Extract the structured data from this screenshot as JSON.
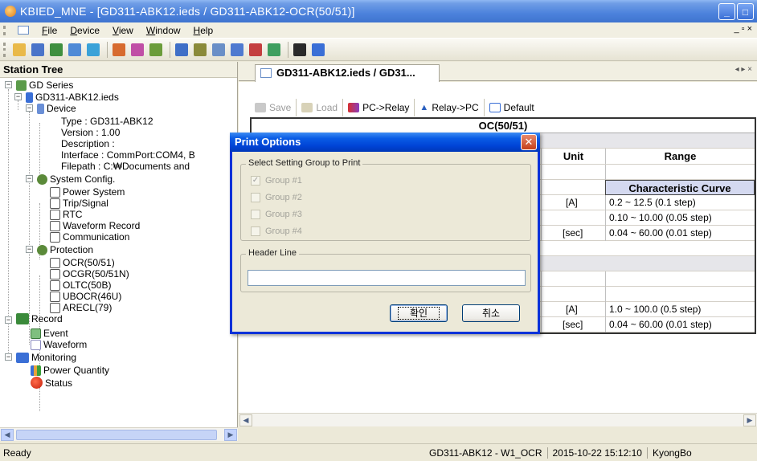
{
  "window": {
    "title": "KBIED_MNE - [GD311-ABK12.ieds / GD311-ABK12-OCR(50/51)]",
    "minimize": "_",
    "restore": "□",
    "close": "X"
  },
  "menu": {
    "items": [
      {
        "ul": "F",
        "rest": "ile"
      },
      {
        "ul": "D",
        "rest": "evice"
      },
      {
        "ul": "V",
        "rest": "iew"
      },
      {
        "ul": "W",
        "rest": "indow"
      },
      {
        "ul": "H",
        "rest": "elp"
      }
    ],
    "mdi_controls": "_ ▫ ×"
  },
  "toolbar": {
    "icons": [
      {
        "name": "open-folder-icon",
        "color": "#e9b949"
      },
      {
        "name": "save-icon",
        "color": "#4a74c9"
      },
      {
        "name": "connect-icon",
        "color": "#3f8f3f"
      },
      {
        "name": "network-icon",
        "color": "#4f8ad6"
      },
      {
        "name": "tree-icon",
        "color": "#3aa2d8"
      },
      {
        "name": "settings-icon",
        "color": "#d76b2f"
      },
      {
        "name": "paint-icon",
        "color": "#c04fa6"
      },
      {
        "name": "download-icon",
        "color": "#6b9c3a"
      },
      {
        "name": "window-icon",
        "color": "#3f6fc7"
      },
      {
        "name": "list-icon",
        "color": "#8a8a3a"
      },
      {
        "name": "tile-icon",
        "color": "#6a8fc7"
      },
      {
        "name": "wave-icon",
        "color": "#4f7ad0"
      },
      {
        "name": "waveform-icon",
        "color": "#c43f3f"
      },
      {
        "name": "transfer-icon",
        "color": "#3f9f5f"
      },
      {
        "name": "close-icon",
        "color": "#2a2a2a"
      },
      {
        "name": "help-icon",
        "color": "#3a6fd6"
      }
    ]
  },
  "station_tree": {
    "title": "Station Tree",
    "nodes": {
      "gd_series": "GD Series",
      "file": "GD311-ABK12.ieds",
      "device": "Device",
      "type": "Type : GD311-ABK12",
      "version": "Version : 1.00",
      "description": "Description :",
      "interface": "Interface : CommPort:COM4, B",
      "filepath": "Filepath : C:₩Documents and",
      "system_config": "System Config.",
      "power_system": "Power System",
      "trip_signal": "Trip/Signal",
      "rtc": "RTC",
      "waveform_record": "Waveform Record",
      "communication": "Communication",
      "protection": "Protection",
      "ocr": "OCR(50/51)",
      "ocgr": "OCGR(50/51N)",
      "oltc": "OLTC(50B)",
      "ubocr": "UBOCR(46U)",
      "arecl": "ARECL(79)",
      "record": "Record",
      "event": "Event",
      "waveform": "Waveform",
      "monitoring": "Monitoring",
      "power_quantity": "Power Quantity",
      "status": "Status"
    }
  },
  "document": {
    "tab_label": "GD311-ABK12.ieds / GD31...",
    "tab_nav": "◂ ▸ ×",
    "buttons": {
      "save": "Save",
      "load": "Load",
      "pc_relay": "PC->Relay",
      "relay_pc": "Relay->PC",
      "default": "Default"
    },
    "grid": {
      "title": "OC(50/51)",
      "col_unit": "Unit",
      "col_range": "Range",
      "curve": "Characteristic Curve",
      "rows": [
        {
          "unit": "[A]",
          "range": "0.2 ~ 12.5 (0.1 step)"
        },
        {
          "unit": "",
          "range": "0.10 ~ 10.00 (0.05 step)"
        },
        {
          "unit": "[sec]",
          "range": "0.04 ~ 60.00 (0.01 step)"
        },
        {
          "unit": "[A]",
          "range": "1.0 ~ 100.0 (0.5 step)"
        },
        {
          "unit": "[sec]",
          "range": "0.04 ~ 60.00 (0.01 step)"
        }
      ]
    }
  },
  "dialog": {
    "title": "Print Options",
    "group_legend": "Select Setting Group to Print",
    "groups": [
      {
        "label": "Group #1",
        "checked": "✓"
      },
      {
        "label": "Group #2",
        "checked": ""
      },
      {
        "label": "Group #3",
        "checked": ""
      },
      {
        "label": "Group #4",
        "checked": ""
      }
    ],
    "header_legend": "Header Line",
    "header_value": "",
    "ok_label": "확인",
    "cancel_label": "취소"
  },
  "statusbar": {
    "left": "Ready",
    "device": "GD311-ABK12 - W1_OCR",
    "datetime": "2015-10-22 15:12:10",
    "user": "KyongBo"
  }
}
